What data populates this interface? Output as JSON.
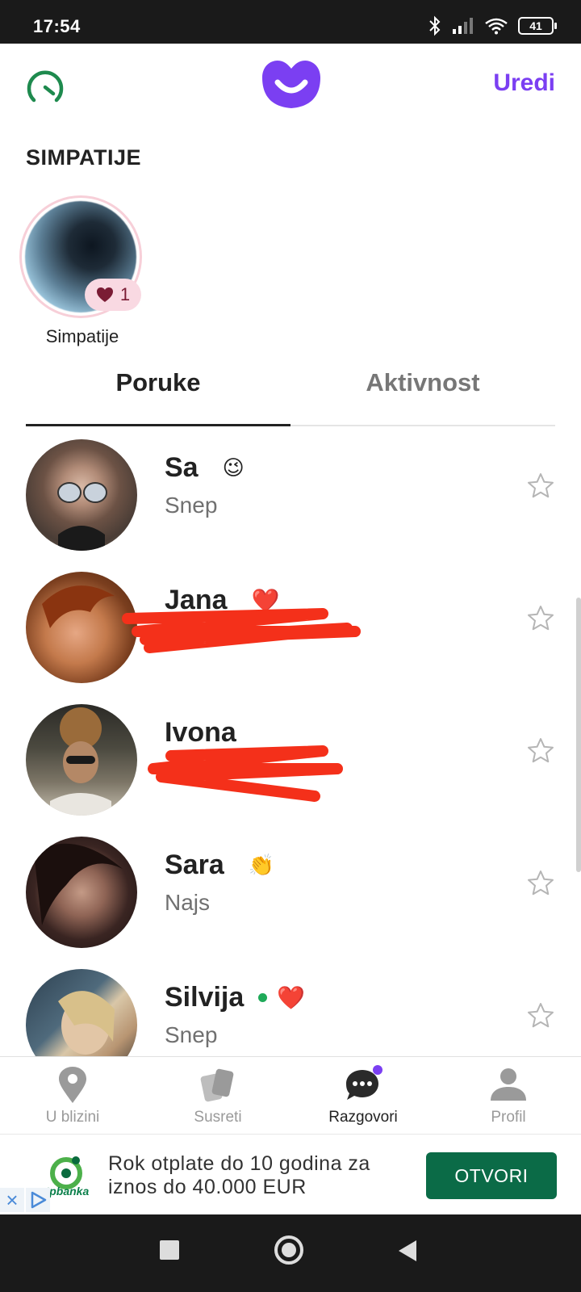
{
  "status_bar": {
    "time": "17:54",
    "battery": "41"
  },
  "header": {
    "edit_label": "Uredi"
  },
  "likes": {
    "section_title": "SIMPATIJE",
    "count": "1",
    "label": "Simpatije"
  },
  "tabs": [
    {
      "label": "Poruke",
      "active": true
    },
    {
      "label": "Aktivnost",
      "active": false
    }
  ],
  "chats": [
    {
      "name": "Sa",
      "emoji": "😉",
      "preview": "Snep"
    },
    {
      "name": "Jana",
      "emoji": "❤️",
      "preview": ""
    },
    {
      "name": "Ivona",
      "emoji": "",
      "preview": ""
    },
    {
      "name": "Sara",
      "emoji": "👏",
      "preview": "Najs"
    },
    {
      "name": "Silvija",
      "emoji": "❤️",
      "preview": "Snep"
    }
  ],
  "bottom_nav": [
    {
      "label": "U blizini",
      "icon": "location-pin-icon"
    },
    {
      "label": "Susreti",
      "icon": "cards-icon"
    },
    {
      "label": "Razgovori",
      "icon": "chat-bubble-icon",
      "active": true
    },
    {
      "label": "Profil",
      "icon": "person-icon"
    }
  ],
  "ad": {
    "brand": "otpbanka",
    "text": "Rok otplate do 10 godina za iznos do 40.000 EUR",
    "button": "OTVORI"
  },
  "colors": {
    "accent": "#7b3ff2",
    "green": "#1faa59",
    "heart": "#d9182b",
    "ad_button": "#0b6b47"
  }
}
